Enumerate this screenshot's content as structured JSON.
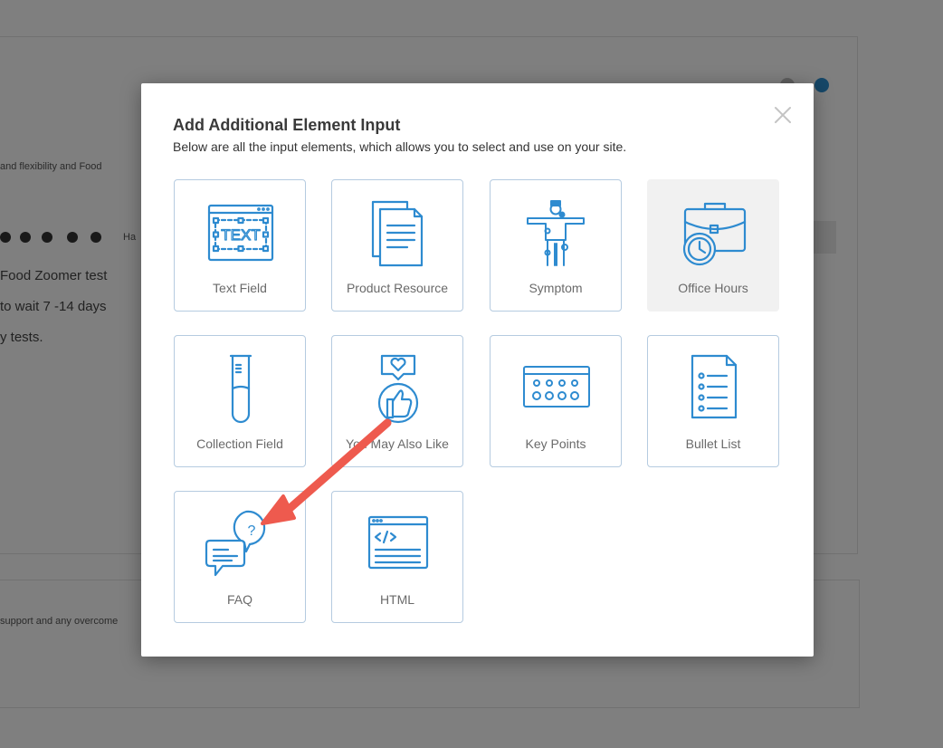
{
  "modal": {
    "title": "Add Additional Element Input",
    "subtitle": "Below are all the input elements, which allows you to select and use on your site.",
    "close_icon": "close-icon",
    "elements": [
      {
        "label": "Text Field",
        "icon": "text-field-icon",
        "state": "default"
      },
      {
        "label": "Product Resource",
        "icon": "documents-icon",
        "state": "default"
      },
      {
        "label": "Symptom",
        "icon": "human-body-icon",
        "state": "default"
      },
      {
        "label": "Office Hours",
        "icon": "briefcase-clock-icon",
        "state": "hover"
      },
      {
        "label": "Collection Field",
        "icon": "test-tube-icon",
        "state": "default"
      },
      {
        "label": "You May Also Like",
        "icon": "thumbs-up-heart-icon",
        "state": "default"
      },
      {
        "label": "Key Points",
        "icon": "rating-board-icon",
        "state": "default"
      },
      {
        "label": "Bullet List",
        "icon": "bullet-list-icon",
        "state": "default"
      },
      {
        "label": "FAQ",
        "icon": "chat-question-icon",
        "state": "default"
      },
      {
        "label": "HTML",
        "icon": "code-window-icon",
        "state": "default"
      }
    ]
  },
  "background": {
    "line1": "Food Zoomer test",
    "line2": "to wait 7 -14 days",
    "line3": "y tests.",
    "small1": "and flexibility and Food",
    "small2": "support and any overcome",
    "rating_label": "Ha"
  },
  "colors": {
    "icon_blue": "#2e8bd0",
    "tile_border": "#b5cbe0",
    "active_tile_bg": "#f1f1f1",
    "annotation_arrow": "#ee5a4e"
  }
}
